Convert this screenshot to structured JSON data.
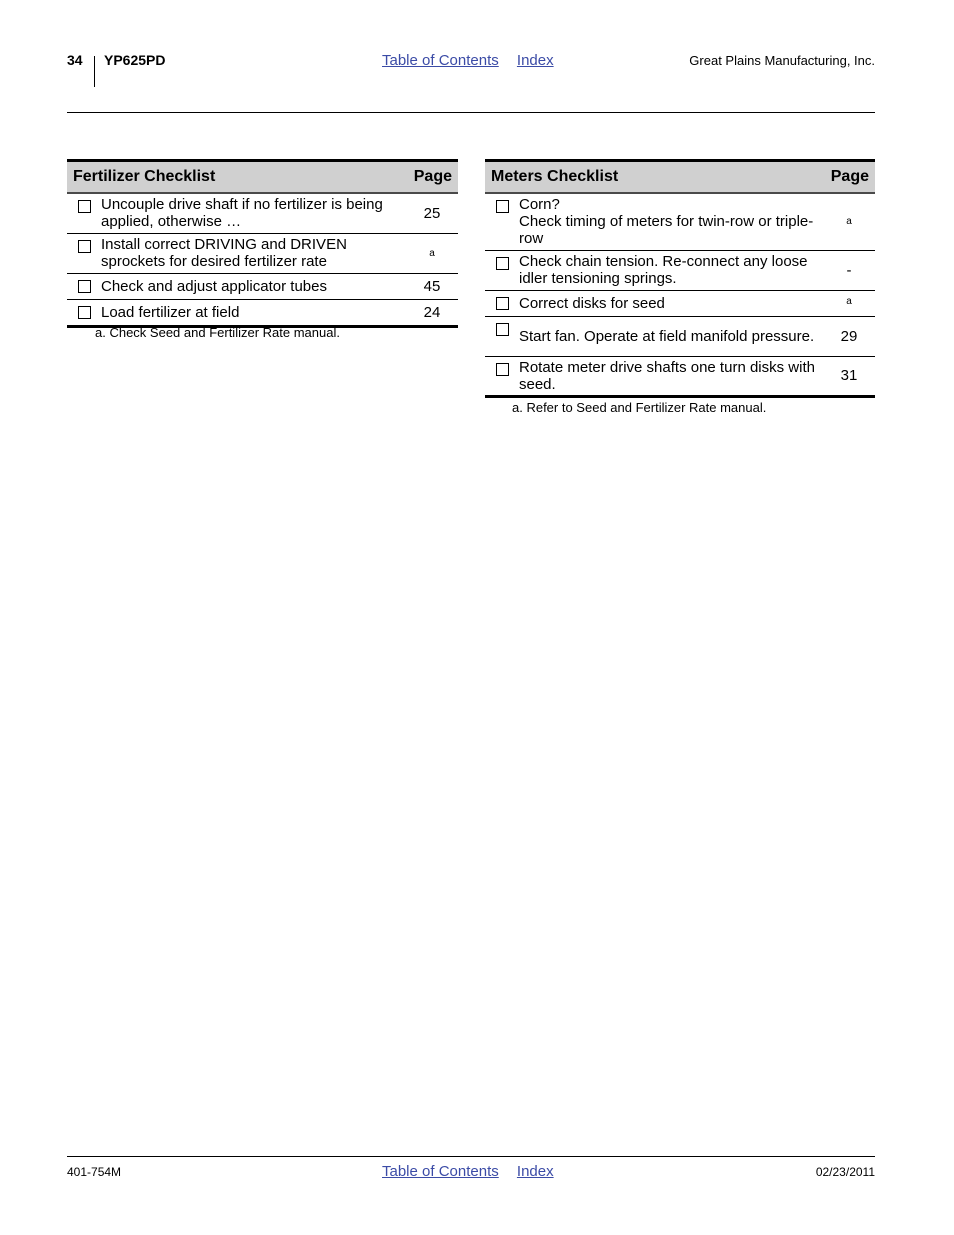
{
  "header": {
    "page_number": "34",
    "model": "YP625PD",
    "links": [
      "Table of Contents",
      "Index"
    ],
    "company": "Great Plains Manufacturing, Inc."
  },
  "fertilizer_checklist": {
    "title": "Fertilizer Checklist",
    "page_header": "Page",
    "rows": [
      {
        "text": "Uncouple drive shaft if no fertilizer is being applied, otherwise …",
        "page": "25",
        "checked": false
      },
      {
        "text": "Install correct DRIVING and DRIVEN sprockets for desired fertilizer rate",
        "page": "a",
        "checked": false
      },
      {
        "text": "Check and adjust applicator tubes",
        "page": "45",
        "checked": false
      },
      {
        "text": "Load fertilizer at field",
        "page": "24",
        "checked": false
      }
    ],
    "footnote": "a.  Check Seed and Fertilizer Rate manual."
  },
  "meters_checklist": {
    "title": "Meters Checklist",
    "page_header": "Page",
    "rows": [
      {
        "text_line1": "Corn?",
        "text": "Check timing of meters for twin-row or triple-row",
        "page": "a",
        "checked": false
      },
      {
        "text": "Check chain tension. Re-connect any loose idler tensioning springs.",
        "page": "-",
        "checked": false
      },
      {
        "text": "Correct disks for seed",
        "page": "a",
        "checked": false
      },
      {
        "text": "Start fan. Operate at field manifold pressure.",
        "page": "29",
        "checked": false
      },
      {
        "text": "Rotate meter drive shafts one turn disks with seed.",
        "page": "31",
        "checked": false
      }
    ],
    "footnote": "a.  Refer to Seed and Fertilizer Rate manual."
  },
  "footer": {
    "doc_number": "401-754M",
    "links": [
      "Table of Contents",
      "Index"
    ],
    "date": "02/23/2011"
  }
}
